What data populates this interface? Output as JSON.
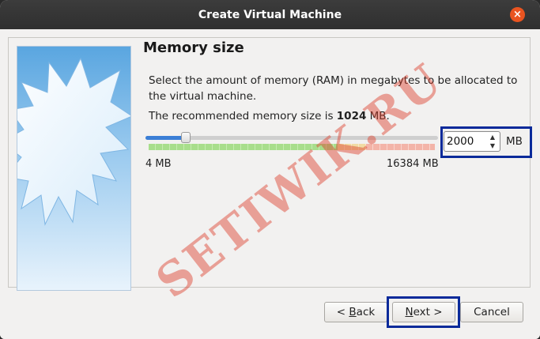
{
  "window": {
    "title": "Create Virtual Machine",
    "close_glyph": "×"
  },
  "page": {
    "heading": "Memory size",
    "description": "Select the amount of memory (RAM) in megabytes to be allocated to the virtual machine.",
    "recommend_prefix": "The recommended memory size is ",
    "recommend_value": "1024",
    "recommend_suffix": " MB."
  },
  "memory_slider": {
    "min_label": "4 MB",
    "max_label": "16384 MB",
    "value_mb": 2000,
    "min_mb": 4,
    "max_mb": 16384
  },
  "memory_input": {
    "value": "2000",
    "unit": "MB",
    "up_glyph": "▲",
    "down_glyph": "▼"
  },
  "buttons": {
    "back_prefix": "< ",
    "back_mnemonic": "B",
    "back_rest": "ack",
    "next_mnemonic": "N",
    "next_rest": "ext >",
    "cancel": "Cancel"
  },
  "watermark": "SETIWIK.RU",
  "colors": {
    "accent": "#3b7fd6",
    "highlight_border": "#0a2a9a",
    "close_button": "#e95420"
  }
}
